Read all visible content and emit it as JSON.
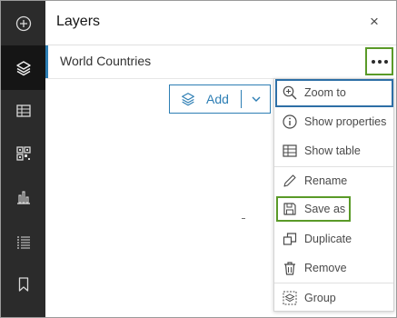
{
  "toolbar": {
    "tools": [
      {
        "name": "add-circle-icon",
        "active": false
      },
      {
        "name": "layers-icon",
        "active": true
      },
      {
        "name": "table-icon",
        "active": false
      },
      {
        "name": "qr-grid-icon",
        "active": false
      },
      {
        "name": "bar-chart-icon",
        "active": false
      },
      {
        "name": "list-icon",
        "active": false
      },
      {
        "name": "bookmark-icon",
        "active": false
      }
    ]
  },
  "panel": {
    "title": "Layers",
    "close_glyph": "×",
    "layer_name": "World Countries",
    "add_label": "Add"
  },
  "menu": {
    "items": [
      {
        "label": "Zoom to",
        "icon": "zoom-in-icon"
      },
      {
        "label": "Show properties",
        "icon": "info-icon"
      },
      {
        "label": "Show table",
        "icon": "table-icon"
      },
      {
        "label": "Rename",
        "icon": "pencil-icon"
      },
      {
        "label": "Save as",
        "icon": "save-icon"
      },
      {
        "label": "Duplicate",
        "icon": "duplicate-icon"
      },
      {
        "label": "Remove",
        "icon": "trash-icon"
      },
      {
        "label": "Group",
        "icon": "group-icon"
      }
    ]
  },
  "colors": {
    "toolbar_bg": "#2b2b2b",
    "toolbar_active": "#151515",
    "accent_blue": "#2d7eb4",
    "highlight_green": "#5a9a28"
  }
}
